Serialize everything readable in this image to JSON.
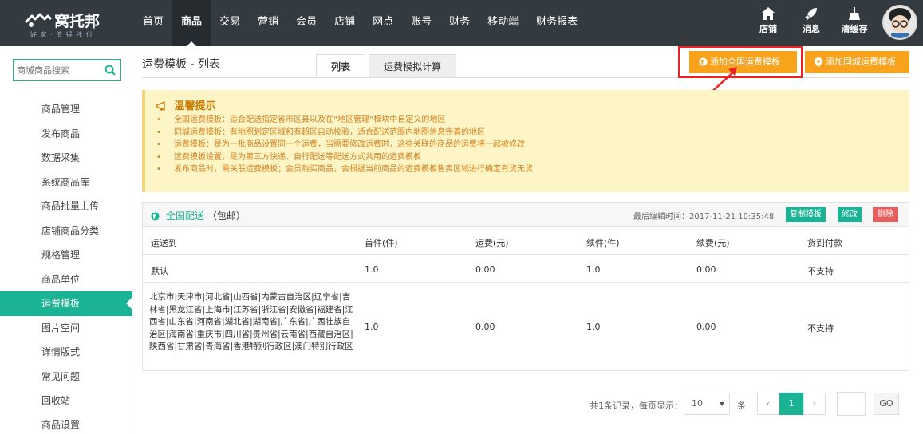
{
  "brand": {
    "name": "窝托邦",
    "slogan": "好 家 · 值 得 托 付"
  },
  "nav": {
    "items": [
      "首页",
      "商品",
      "交易",
      "营销",
      "会员",
      "店铺",
      "网点",
      "账号",
      "财务",
      "移动端",
      "财务报表"
    ],
    "active": "商品"
  },
  "top_icons": [
    {
      "label": "店铺",
      "icon": "home-icon"
    },
    {
      "label": "消息",
      "icon": "rocket-icon"
    },
    {
      "label": "清缓存",
      "icon": "broom-icon"
    }
  ],
  "sidebar": {
    "search_placeholder": "商城商品搜索",
    "items": [
      "商品管理",
      "发布商品",
      "数据采集",
      "系统商品库",
      "商品批量上传",
      "店铺商品分类",
      "规格管理",
      "商品单位",
      "运费模板",
      "图片空间",
      "详情版式",
      "常见问题",
      "回收站",
      "商品设置"
    ],
    "active": "运费模板"
  },
  "page": {
    "title": "运费模板 - 列表",
    "tabs": [
      "列表",
      "运费模拟计算"
    ],
    "active_tab": "列表",
    "btn_national": "添加全国运费模板",
    "btn_city": "添加同城运费模板"
  },
  "notice": {
    "title": "温馨提示",
    "items": [
      "全国运费模板：适合配送指定省市区县以及在“地区管理”模块中自定义的地区",
      "同城运费模板：有地图划定区域和有超区自动校验，适合配送范围内地图信息完善的地区",
      "运费模板：是为一批商品设置同一个运费，当需要修改运费时，这些关联的商品的运费将一起被修改",
      "运费模板设置，是为第三方快递、自行配送等配送方式共用的运费模板",
      "发布商品时，需关联运费模板；会员购买商品，会根据当前商品的运费模板售卖区域进行确定有货无货"
    ]
  },
  "panel": {
    "title": "全国配送",
    "subtitle": "（包邮）",
    "edit_time": "最后编辑时间：2017-11-21 10:35:48",
    "btn_copy": "复制模板",
    "btn_edit": "修改",
    "btn_delete": "删除",
    "columns": [
      "运送到",
      "首件(件)",
      "运费(元)",
      "续件(件)",
      "续费(元)",
      "货到付款"
    ],
    "rows": [
      [
        "默认",
        "1.0",
        "0.00",
        "1.0",
        "0.00",
        "不支持"
      ],
      [
        "北京市|天津市|河北省|山西省|内蒙古自治区|辽宁省|吉林省|黑龙江省|上海市|江苏省|浙江省|安徽省|福建省|江西省|山东省|河南省|湖北省|湖南省|广东省|广西壮族自治区|海南省|重庆市|四川省|贵州省|云南省|西藏自治区|陕西省|甘肃省|青海省|香港特别行政区|澳门特别行政区",
        "1.0",
        "0.00",
        "1.0",
        "0.00",
        "不支持"
      ]
    ]
  },
  "pager": {
    "summary": "共1条记录，每页显示：",
    "page_size": "10",
    "unit": "条",
    "prev": "‹",
    "current": "1",
    "next": "›",
    "go": "GO"
  },
  "colors": {
    "topbar": "#333a40",
    "accent": "#1ab394",
    "orange": "#f8a31b",
    "danger": "#e55e5e",
    "highlight": "#ee2222"
  }
}
